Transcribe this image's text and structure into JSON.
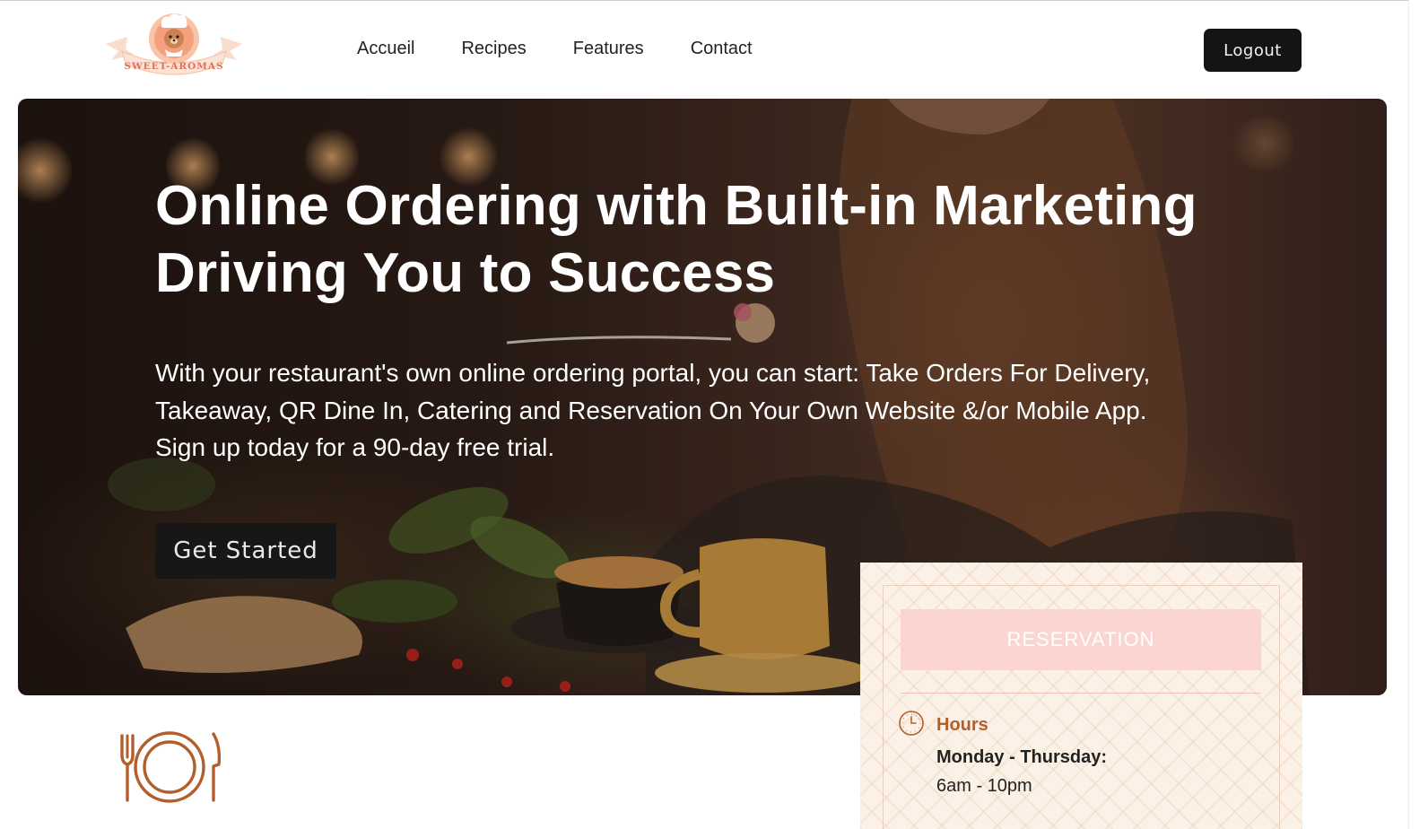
{
  "brand": {
    "logo_text": "SWEET-AROMAS"
  },
  "nav": [
    {
      "label": "Accueil"
    },
    {
      "label": "Recipes"
    },
    {
      "label": "Features"
    },
    {
      "label": "Contact"
    }
  ],
  "header": {
    "logout_label": "Logout"
  },
  "hero": {
    "title_line1": "Online Ordering with Built-in Marketing",
    "title_line2": "Driving You to Success",
    "body_line1": "With your restaurant's own online ordering portal, you can start: Take Orders For Delivery,",
    "body_line2": "Takeaway, QR Dine In, Catering and Reservation On Your Own Website &/or Mobile App.",
    "body_line3": "Sign up today for a 90-day free trial.",
    "cta_label": "Get Started"
  },
  "reservation": {
    "button_label": "RESERVATION",
    "hours_title": "Hours",
    "days": "Monday - Thursday:",
    "time": "6am - 10pm"
  },
  "colors": {
    "accent": "#b35e2c",
    "dark_button": "#141414",
    "reservation_button": "#fbd5d2",
    "card_bg": "#fcf1e6"
  },
  "icons": [
    "chef-logo",
    "clock-icon",
    "plate-cutlery-icon"
  ]
}
